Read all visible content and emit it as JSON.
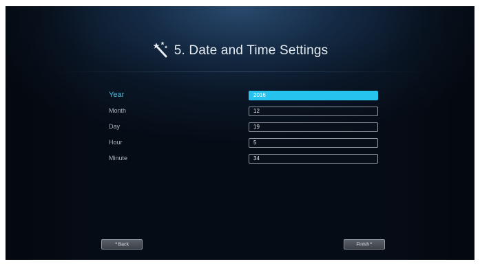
{
  "header": {
    "title": "5. Date and Time Settings",
    "icon": "magic-wand-icon"
  },
  "fields": [
    {
      "label": "Year",
      "value": "2016",
      "selected": true
    },
    {
      "label": "Month",
      "value": "12",
      "selected": false
    },
    {
      "label": "Day",
      "value": "19",
      "selected": false
    },
    {
      "label": "Hour",
      "value": "5",
      "selected": false
    },
    {
      "label": "Minute",
      "value": "34",
      "selected": false
    }
  ],
  "nav": {
    "back_label": "Back",
    "back_arrow": "◂",
    "finish_label": "Finish",
    "finish_arrow": "▸"
  },
  "colors": {
    "accent": "#27c3ef",
    "active_label": "#3ec3ea",
    "background": "#0a1626"
  }
}
